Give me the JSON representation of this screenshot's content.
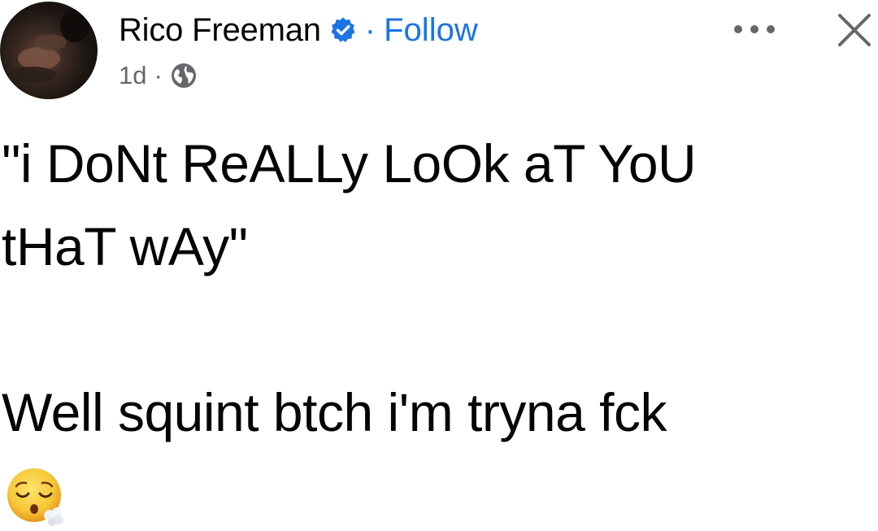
{
  "author": {
    "name": "Rico Freeman",
    "verified_icon": "verified-badge-icon",
    "separator": "·",
    "follow_label": "Follow"
  },
  "meta": {
    "time": "1d",
    "separator": "·",
    "audience_icon": "globe-icon"
  },
  "actions": {
    "more_icon": "more-horizontal-icon",
    "close_icon": "close-icon"
  },
  "post": {
    "line1": "\"i DoNt ReALLy LoOk aT YoU",
    "line2": "tHaT wAy\"",
    "line3": "Well squint btch i'm tryna fck",
    "emoji_icon": "face-exhaling-emoji"
  },
  "colors": {
    "text": "#050505",
    "secondary": "#65676b",
    "link": "#1b74e4",
    "verified": "#1b74e4",
    "emoji": "#f7c737"
  }
}
